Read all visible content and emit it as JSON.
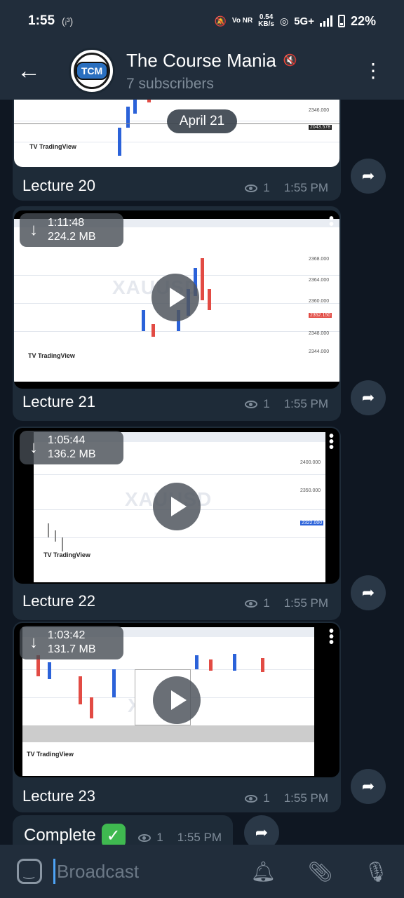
{
  "status_bar": {
    "time": "1:55",
    "wifi_calling": "(ᵢ³)",
    "network_speed": "0.54",
    "network_unit": "KB/s",
    "volte": "Vo NR",
    "network_type": "5G+",
    "battery": "22%"
  },
  "header": {
    "channel_name": "The Course Mania",
    "subtitle": "7 subscribers",
    "avatar_text": "TCM"
  },
  "chat": {
    "date_pill": "April 21",
    "messages": [
      {
        "caption": "Lecture 20",
        "views": "1",
        "time": "1:55 PM"
      },
      {
        "caption": "Lecture 21",
        "views": "1",
        "time": "1:55 PM",
        "duration": "1:11:48",
        "size": "224.2 MB",
        "watermark": "XAUUSD"
      },
      {
        "caption": "Lecture 22",
        "views": "1",
        "time": "1:55 PM",
        "duration": "1:05:44",
        "size": "136.2 MB",
        "watermark": "XAUUSD"
      },
      {
        "caption": "Lecture 23",
        "views": "1",
        "time": "1:55 PM",
        "duration": "1:03:42",
        "size": "131.7 MB",
        "watermark": "XA"
      },
      {
        "caption": "Complete",
        "views": "1",
        "time": "1:55 PM"
      }
    ]
  },
  "composer": {
    "placeholder": "Broadcast"
  },
  "colors": {
    "header_bg": "#212d3b",
    "bubble_bg": "#1e2b38",
    "accent": "#4ea4f6",
    "check_green": "#3fb950"
  }
}
